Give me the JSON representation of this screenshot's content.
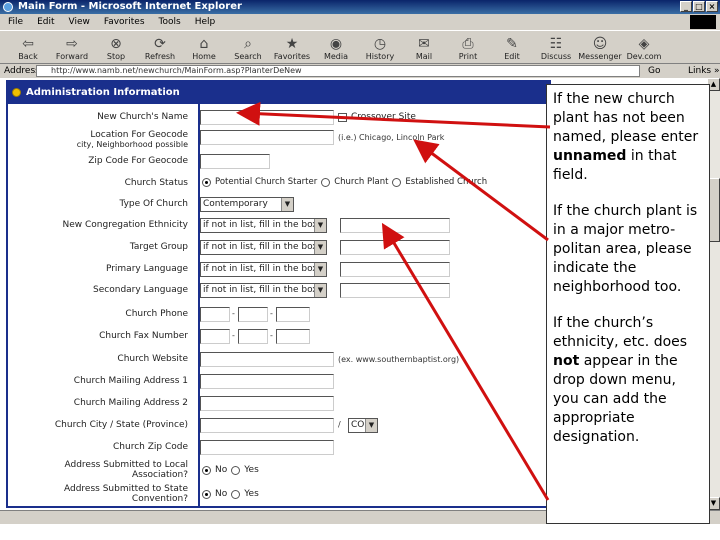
{
  "window": {
    "title": "Main Form - Microsoft Internet Explorer",
    "controls": [
      "_",
      "□",
      "×"
    ]
  },
  "menu": [
    "File",
    "Edit",
    "View",
    "Favorites",
    "Tools",
    "Help"
  ],
  "toolbar": [
    {
      "label": "Back",
      "icon": "back-arrow-icon",
      "glyph": "⇦"
    },
    {
      "label": "Forward",
      "icon": "forward-arrow-icon",
      "glyph": "⇨"
    },
    {
      "label": "Stop",
      "icon": "stop-icon",
      "glyph": "⊗"
    },
    {
      "label": "Refresh",
      "icon": "refresh-icon",
      "glyph": "⟳"
    },
    {
      "label": "Home",
      "icon": "home-icon",
      "glyph": "⌂"
    },
    {
      "label": "Search",
      "icon": "search-icon",
      "glyph": "⌕"
    },
    {
      "label": "Favorites",
      "icon": "favorites-icon",
      "glyph": "★"
    },
    {
      "label": "Media",
      "icon": "media-icon",
      "glyph": "◉"
    },
    {
      "label": "History",
      "icon": "history-icon",
      "glyph": "◷"
    },
    {
      "label": "Mail",
      "icon": "mail-icon",
      "glyph": "✉"
    },
    {
      "label": "Print",
      "icon": "print-icon",
      "glyph": "⎙"
    },
    {
      "label": "Edit",
      "icon": "edit-icon",
      "glyph": "✎"
    },
    {
      "label": "Discuss",
      "icon": "discuss-icon",
      "glyph": "☷"
    },
    {
      "label": "Messenger",
      "icon": "messenger-icon",
      "glyph": "☺"
    },
    {
      "label": "Dev.com",
      "icon": "devcom-icon",
      "glyph": "◈"
    }
  ],
  "address": {
    "label": "Address",
    "url": "http://www.namb.net/newchurch/MainForm.asp?PlanterDeNew",
    "go": "Go",
    "links": "Links »"
  },
  "form": {
    "section_title": "Administration Information",
    "new_church_name": "New Church's Name",
    "crossover": "Crossover Site",
    "location_geocode": "Location For Geocode",
    "location_geocode_sub": "city, Neighborhood possible",
    "location_hint": "(i.e.) Chicago, Lincoln Park",
    "zip_geocode": "Zip Code For Geocode",
    "church_status": "Church Status",
    "status_options": [
      "Potential Church Starter",
      "Church Plant",
      "Established Church"
    ],
    "type_of_church": "Type Of Church",
    "type_value": "Contemporary",
    "ethnicity": "New Congregation Ethnicity",
    "target_group": "Target Group",
    "primary_language": "Primary Language",
    "secondary_language": "Secondary Language",
    "dropdown_default": "if not in list, fill in the box",
    "church_phone": "Church Phone",
    "church_fax": "Church Fax Number",
    "church_website": "Church Website",
    "website_hint": "(ex. www.southernbaptist.org)",
    "mailing1": "Church Mailing Address 1",
    "mailing2": "Church Mailing Address 2",
    "city_state": "Church City / State (Province)",
    "state_value": "CO",
    "zip_code": "Church Zip Code",
    "local_assoc": "Address Submitted to Local",
    "local_assoc_2": "Association?",
    "state_conv": "Address Submitted to State",
    "state_conv_2": "Convention?",
    "no": "No",
    "yes": "Yes"
  },
  "callout": {
    "p1_a": "If the new church plant has not been named, please enter ",
    "p1_b": "unnamed",
    "p1_c": " in that field.",
    "p2": "If the church plant is in a major metro-politan area, please indicate the neighborhood too.",
    "p3_a": "If the church’s ethnicity, etc. does ",
    "p3_b": "not",
    "p3_c": " appear in the drop down menu, you can add the appropriate designation."
  },
  "colors": {
    "arrow": "#d01010",
    "form_border": "#1a2f8c"
  }
}
